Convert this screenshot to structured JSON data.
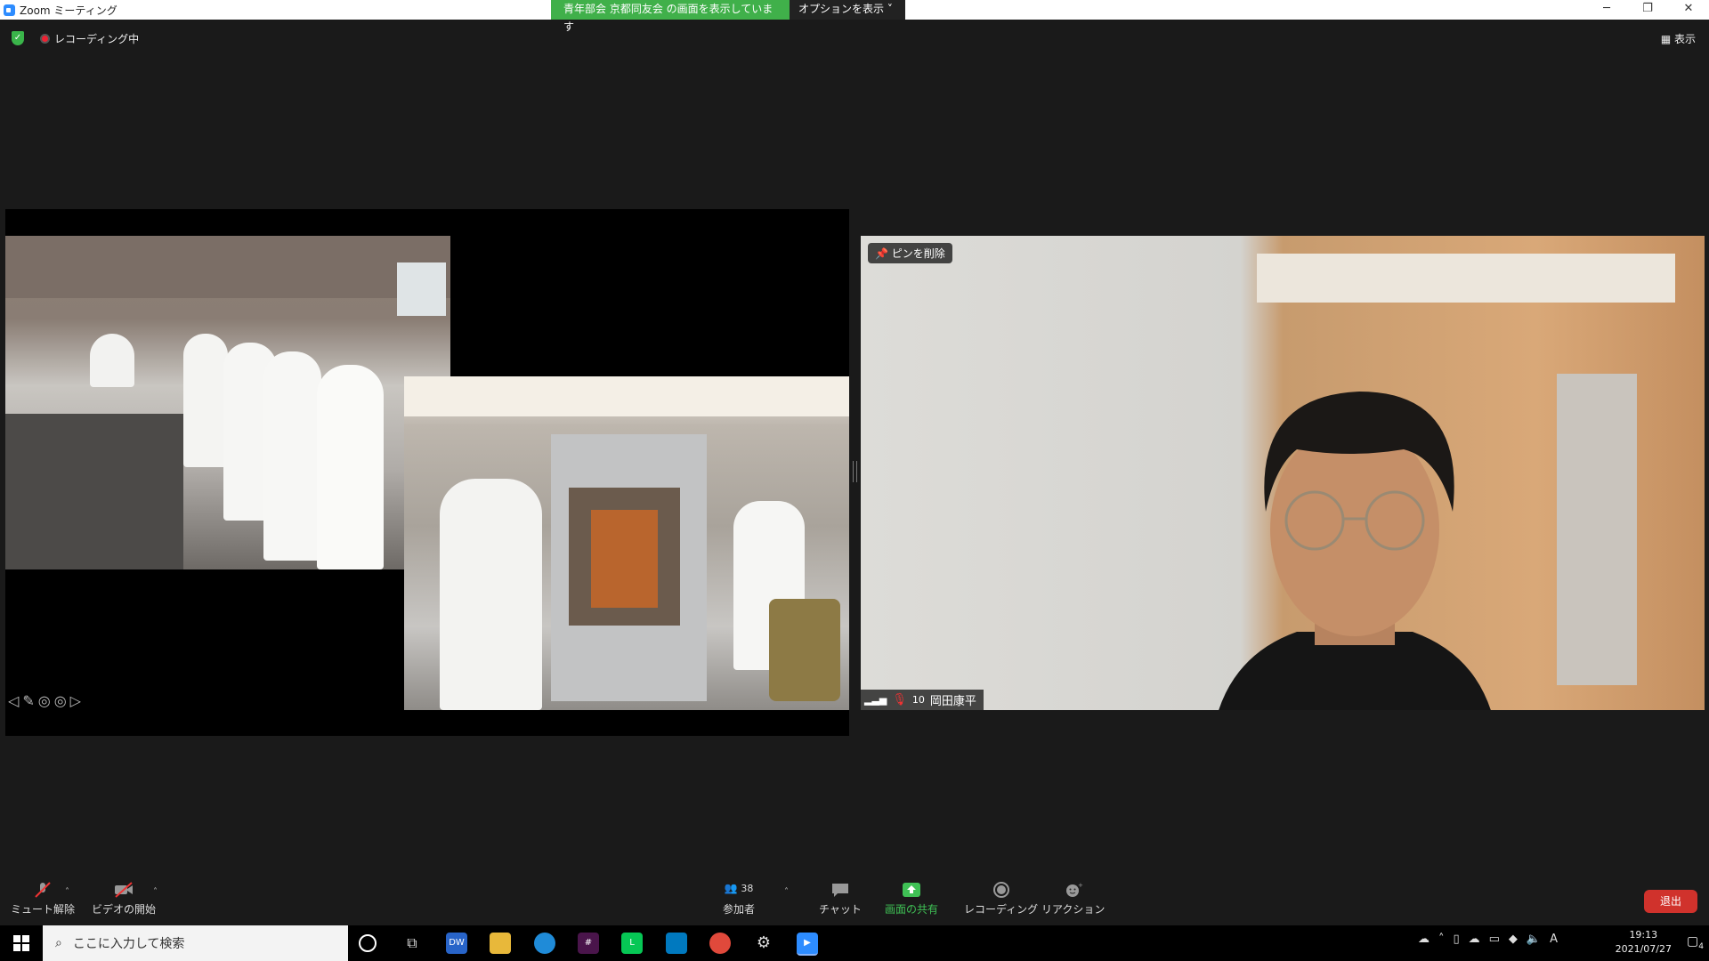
{
  "window": {
    "title": "Zoom ミーティング",
    "share_banner": "青年部会 京都同友会 の画面を表示しています",
    "options_label": "オプションを表示",
    "controls": [
      "─",
      "❐",
      "✕"
    ]
  },
  "status": {
    "recording_label": "レコーディング中",
    "view_label": "表示"
  },
  "share": {
    "photo1_desc": "kitchen-staff-photo",
    "photo2_desc": "oven-photo",
    "tools": [
      "◁",
      "✎",
      "◎",
      "◎",
      "▷"
    ]
  },
  "video": {
    "pin_label": "ピンを削除",
    "signal": "10",
    "name": "岡田康平",
    "colors": {
      "wall": "#dddcd8",
      "door": "#d9a878"
    }
  },
  "toolbar": {
    "mute_label": "ミュート解除",
    "video_label": "ビデオの開始",
    "participants_label": "参加者",
    "participants_count": "38",
    "chat_label": "チャット",
    "share_label": "画面の共有",
    "record_label": "レコーディング",
    "reaction_label": "リアクション",
    "leave_label": "退出",
    "share_color": "#3fc155",
    "leave_color": "#d0322c"
  },
  "taskbar": {
    "search_placeholder": "ここに入力して検索",
    "time": "19:13",
    "date": "2021/07/27",
    "ime": "A",
    "notif_count": "4",
    "apps": [
      "cortana-icon",
      "task-view-icon",
      "dw-icon",
      "file-explorer-icon",
      "edge-icon",
      "slack-icon",
      "line-icon",
      "trello-icon",
      "chrome-icon",
      "settings-icon",
      "zoom-icon"
    ]
  }
}
